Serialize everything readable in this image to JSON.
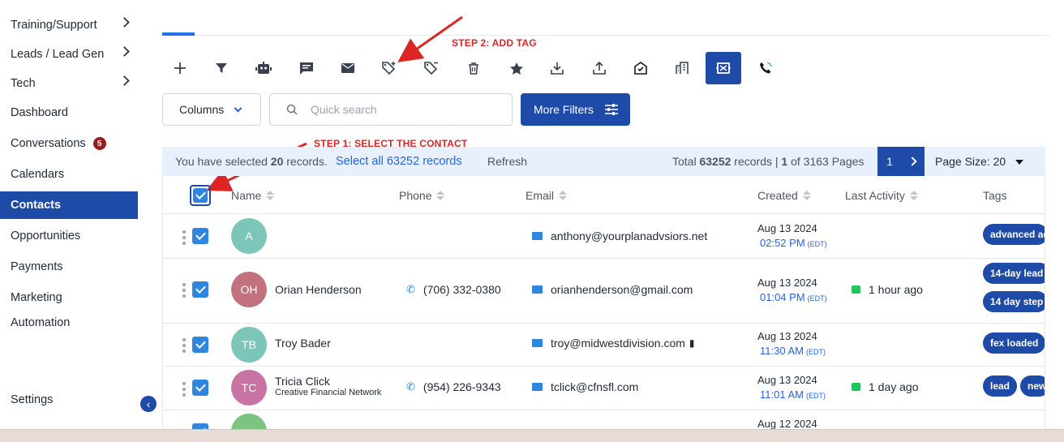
{
  "sidebar": {
    "items": [
      {
        "label": "Training/Support",
        "chevron": true
      },
      {
        "label": "Leads / Lead Gen",
        "chevron": true
      },
      {
        "label": "Tech",
        "chevron": true
      },
      {
        "label": "Dashboard"
      },
      {
        "label": "Conversations",
        "badge": "5"
      },
      {
        "label": "Calendars"
      },
      {
        "label": "Contacts",
        "active": true
      },
      {
        "label": "Opportunities"
      },
      {
        "label": "Payments"
      },
      {
        "label": "Marketing"
      },
      {
        "label": "Automation"
      }
    ],
    "settings_label": "Settings"
  },
  "annotations": {
    "step2": "STEP 2: ADD TAG",
    "step1": "STEP 1: SELECT THE CONTACT"
  },
  "toolbar": {
    "icons": [
      "plus-icon",
      "filter-icon",
      "robot-icon",
      "message-icon",
      "mail-icon",
      "add-tag-icon",
      "remove-tag-icon",
      "trash-icon",
      "star-icon",
      "download-icon",
      "upload-icon",
      "mail-check-icon",
      "building-icon",
      "merge-icon",
      "phone-call-icon"
    ]
  },
  "controls": {
    "columns_label": "Columns",
    "search_placeholder": "Quick search",
    "more_filters_label": "More Filters"
  },
  "selection": {
    "prefix": "You have selected ",
    "count": "20",
    "suffix": " records.",
    "select_all": "Select all 63252 records",
    "refresh": "Refresh",
    "total_prefix": "Total ",
    "total": "63252",
    "total_mid": " records | ",
    "page": "1",
    "page_suffix": " of 3163 Pages",
    "current_page": "1",
    "page_size": "Page Size: 20"
  },
  "table": {
    "headers": {
      "name": "Name",
      "phone": "Phone",
      "email": "Email",
      "created": "Created",
      "last_activity": "Last Activity",
      "tags": "Tags"
    },
    "rows": [
      {
        "initials": "A",
        "color": "#7cc5b9",
        "name": "",
        "company": "",
        "phone": "",
        "email": "anthony@yourplanadvsiors.net",
        "date": "Aug 13 2024",
        "time": "02:52 PM",
        "tz": "(EDT)",
        "activity": "",
        "tags": [
          "advanced ad"
        ]
      },
      {
        "initials": "OH",
        "color": "#c2727d",
        "name": "Orian Henderson",
        "company": "",
        "phone": "(706) 332-0380",
        "email": "orianhenderson@gmail.com",
        "date": "Aug 13 2024",
        "time": "01:04 PM",
        "tz": "(EDT)",
        "activity": "1 hour ago",
        "tags": [
          "14-day lead",
          "14 day step 1"
        ]
      },
      {
        "initials": "TB",
        "color": "#7cc5b9",
        "name": "Troy Bader",
        "company": "",
        "phone": "",
        "email": "troy@midwestdivision.com",
        "date": "Aug 13 2024",
        "time": "11:30 AM",
        "tz": "(EDT)",
        "activity": "",
        "tags": [
          "fex loaded"
        ]
      },
      {
        "initials": "TC",
        "color": "#c774a2",
        "name": "Tricia Click",
        "company": "Creative Financial Network",
        "phone": "(954) 226-9343",
        "email": "tclick@cfnsfl.com",
        "date": "Aug 13 2024",
        "time": "11:01 AM",
        "tz": "(EDT)",
        "activity": "1 day ago",
        "tags": [
          "lead",
          "new"
        ]
      },
      {
        "initials": "",
        "color": "#7dc47f",
        "name": "",
        "company": "",
        "phone": "",
        "email": "",
        "date": "Aug 12 2024",
        "time": "",
        "tz": "",
        "activity": "",
        "tags": []
      }
    ]
  },
  "colors": {
    "primary": "#1e4aa8",
    "checkbox": "#2e86de",
    "annotation": "#dc2626"
  }
}
